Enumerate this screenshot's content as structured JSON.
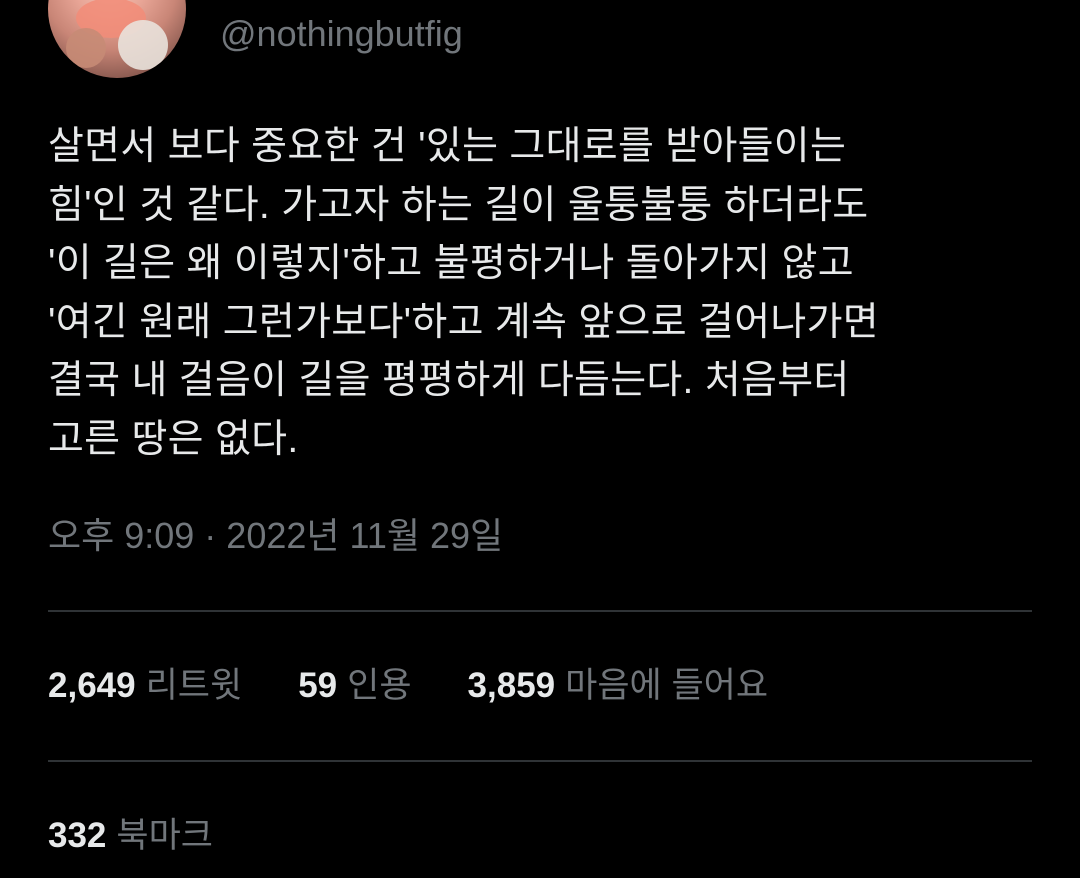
{
  "author": {
    "handle": "@nothingbutfig",
    "avatar_icon": "profile-photo-icon"
  },
  "tweet": {
    "lines": [
      "살면서 보다 중요한 건 '있는 그대로를 받아들이는",
      "힘'인 것 같다. 가고자 하는 길이 울퉁불퉁 하더라도",
      "'이 길은 왜 이렇지'하고 불평하거나 돌아가지 않고",
      "'여긴 원래 그런가보다'하고 계속 앞으로 걸어나가면",
      "결국 내 걸음이 길을 평평하게 다듬는다. 처음부터",
      "고른 땅은 없다."
    ],
    "timestamp": "오후 9:09 · 2022년 11월 29일"
  },
  "stats": {
    "retweets": {
      "count": "2,649",
      "label": "리트윗"
    },
    "quotes": {
      "count": "59",
      "label": "인용"
    },
    "likes": {
      "count": "3,859",
      "label": "마음에 들어요"
    },
    "bookmarks": {
      "count": "332",
      "label": "북마크"
    }
  },
  "colors": {
    "background": "#000000",
    "text_primary": "#e7e9ea",
    "text_secondary": "#71767b",
    "divider": "#2f3336"
  }
}
